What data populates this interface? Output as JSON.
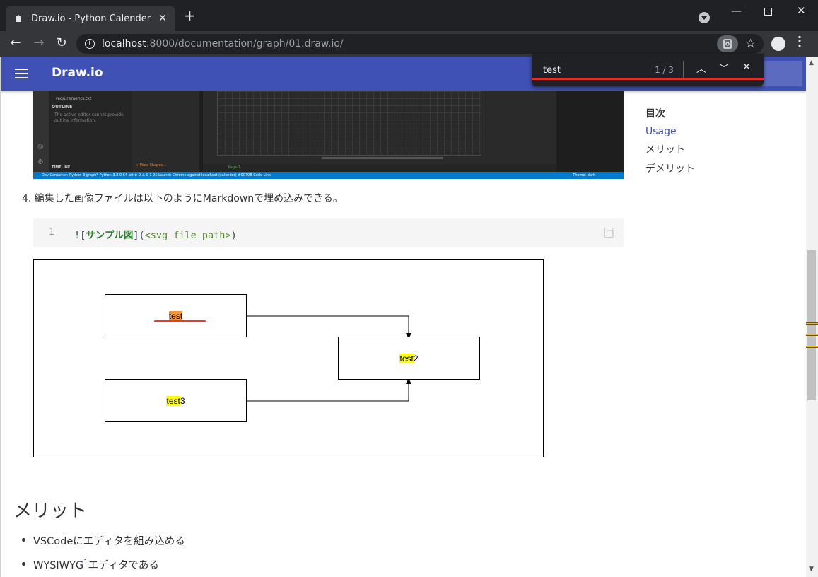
{
  "browser": {
    "tab_title": "Draw.io - Python Calender",
    "url_host": "localhost",
    "url_path": ":8000/documentation/graph/01.draw.io/"
  },
  "find": {
    "query": "test",
    "count": "1 / 3"
  },
  "site": {
    "title": "Draw.io"
  },
  "screenshot": {
    "sidebar_file": "requirements.txt",
    "outline_label": "OUTLINE",
    "outline_msg": "The active editor cannot provide outline information.",
    "timeline_label": "TIMELINE",
    "more_shapes": "+ More Shapes...",
    "page_tab": "Page-1",
    "status_text": "Dev Container: Python 3   graph*   Python 3.8.0 64-bit   ⊗ 0 ⚠ 0   1   25   Launch Chrome against localhost (calender)   #0079B   Code Link",
    "theme_text": "Theme: dark"
  },
  "content": {
    "step4": "4. 編集した画像ファイルは以下のようにMarkdownで埋め込みできる。",
    "code": {
      "line_no": "1",
      "prefix": "![",
      "label": "サンプル図",
      "mid": "](",
      "path": "<svg file path>",
      "suffix": ")"
    },
    "diagram": {
      "node1": {
        "hl": "test",
        "rest": ""
      },
      "node2": {
        "hl": "test",
        "rest": "2"
      },
      "node3": {
        "hl": "test",
        "rest": "3"
      }
    },
    "merit_heading": "メリット",
    "bullets": [
      {
        "text": "VSCodeにエディタを組み込める"
      },
      {
        "pre": "WYSIWYG",
        "sup": "1",
        "post": "エディタである"
      }
    ]
  },
  "toc": {
    "title": "目次",
    "items": [
      "Usage",
      "メリット",
      "デメリット"
    ],
    "active_index": 0
  },
  "colors": {
    "appbar": "#3f51b5",
    "highlight": "#ffff00",
    "current_highlight": "#ff9632",
    "find_underline": "#d93025"
  }
}
